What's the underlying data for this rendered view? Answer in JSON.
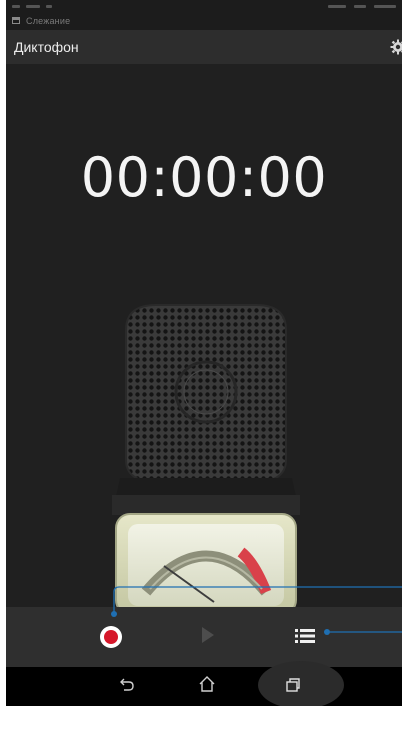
{
  "notification": {
    "text": "Cлежание"
  },
  "app": {
    "title": "Диктофон"
  },
  "timer": {
    "value": "00:00:00"
  },
  "controls": {
    "record": {
      "icon": "record-icon",
      "color": "#d6172a"
    },
    "play": {
      "icon": "play-icon",
      "enabled": false
    },
    "list": {
      "icon": "list-icon"
    }
  },
  "navbar": {
    "items": [
      "back-icon",
      "home-icon",
      "recent-apps-icon"
    ]
  },
  "colors": {
    "background": "#202020",
    "appbar": "#2d2d2d",
    "accent_callout": "#1f6fb2",
    "record_red": "#d6172a"
  }
}
